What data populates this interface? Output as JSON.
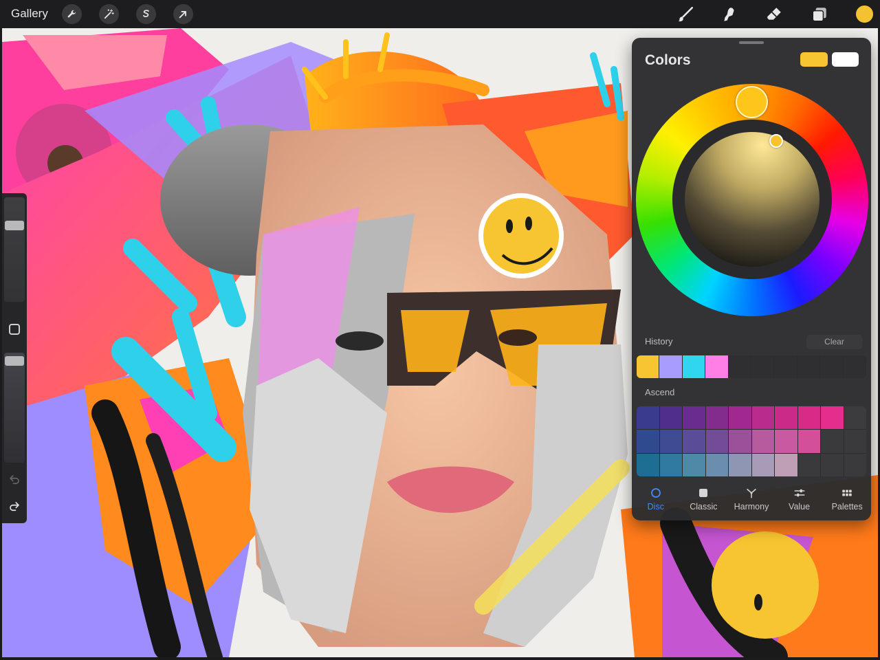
{
  "toolbar": {
    "gallery_label": "Gallery",
    "left_tools": [
      {
        "name": "actions",
        "icon": "wrench-icon"
      },
      {
        "name": "adjustments",
        "icon": "magic-wand-icon"
      },
      {
        "name": "selection",
        "icon": "selection-s-icon"
      },
      {
        "name": "transform",
        "icon": "arrow-cursor-icon"
      }
    ],
    "right_tools": [
      {
        "name": "brush",
        "icon": "brush-icon"
      },
      {
        "name": "smudge",
        "icon": "smudge-icon"
      },
      {
        "name": "eraser",
        "icon": "eraser-icon"
      },
      {
        "name": "layers",
        "icon": "layers-icon"
      }
    ],
    "current_color": "#F4C230"
  },
  "colors_panel": {
    "title": "Colors",
    "primary_color": "#F7C531",
    "secondary_color": "#FFFFFF",
    "history_label": "History",
    "clear_label": "Clear",
    "history_colors": [
      "#F7C531",
      "#A89CFF",
      "#2FD6EE",
      "#FF7FE6",
      "#2F2F31",
      "#2F2F31",
      "#2F2F31",
      "#2F2F31",
      "#2F2F31",
      "#2F2F31"
    ],
    "palette_name": "Ascend",
    "palette_rows": [
      [
        "#3A3A8E",
        "#4F2F8A",
        "#6A2D8F",
        "#842C8E",
        "#A0288E",
        "#B92B8C",
        "#CB2A88",
        "#DA2A87",
        "#E52D8D",
        "#3C3C3E"
      ],
      [
        "#2F4A8E",
        "#3F4B92",
        "#5A4C96",
        "#724C96",
        "#9A5199",
        "#B65B9E",
        "#C75AA0",
        "#D34F9A",
        "#3A3A3C",
        "#3A3A3C"
      ],
      [
        "#1E6E93",
        "#3079A0",
        "#4E89A8",
        "#6B8DAE",
        "#8E96B4",
        "#A79BB7",
        "#BE9FB6",
        "#3A3A3C",
        "#3A3A3C",
        "#3A3A3C"
      ]
    ],
    "tabs": [
      {
        "label": "Disc",
        "icon": "disc-icon",
        "active": true
      },
      {
        "label": "Classic",
        "icon": "classic-square-icon",
        "active": false
      },
      {
        "label": "Harmony",
        "icon": "harmony-icon",
        "active": false
      },
      {
        "label": "Value",
        "icon": "sliders-icon",
        "active": false
      },
      {
        "label": "Palettes",
        "icon": "palettes-grid-icon",
        "active": false
      }
    ]
  }
}
